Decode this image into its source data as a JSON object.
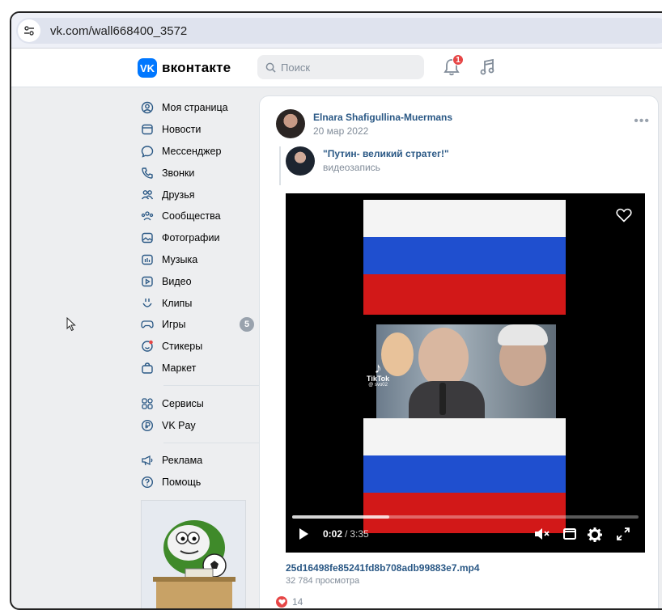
{
  "browser": {
    "url": "vk.com/wall668400_3572"
  },
  "header": {
    "logo_text": "вконтакте",
    "logo_mark": "VK",
    "search_placeholder": "Поиск",
    "notification_count": "1"
  },
  "sidebar": {
    "items": [
      {
        "label": "Моя страница",
        "icon": "user-circle-icon"
      },
      {
        "label": "Новости",
        "icon": "news-icon"
      },
      {
        "label": "Мессенджер",
        "icon": "chat-icon"
      },
      {
        "label": "Звонки",
        "icon": "phone-icon"
      },
      {
        "label": "Друзья",
        "icon": "friends-icon"
      },
      {
        "label": "Сообщества",
        "icon": "communities-icon"
      },
      {
        "label": "Фотографии",
        "icon": "photos-icon"
      },
      {
        "label": "Музыка",
        "icon": "music-icon"
      },
      {
        "label": "Видео",
        "icon": "video-icon"
      },
      {
        "label": "Клипы",
        "icon": "clips-icon"
      },
      {
        "label": "Игры",
        "icon": "games-icon",
        "count": "5"
      },
      {
        "label": "Стикеры",
        "icon": "stickers-icon"
      },
      {
        "label": "Маркет",
        "icon": "market-icon"
      }
    ],
    "services": [
      {
        "label": "Сервисы",
        "icon": "services-icon"
      },
      {
        "label": "VK Pay",
        "icon": "vkpay-icon"
      }
    ],
    "misc": [
      {
        "label": "Реклама",
        "icon": "megaphone-icon"
      },
      {
        "label": "Помощь",
        "icon": "help-icon"
      }
    ]
  },
  "post": {
    "author": "Elnara Shafigullina-Muermans",
    "date": "20 мар 2022",
    "repost": {
      "title": "\"Путин- великий стратег!\"",
      "subtitle": "видеозапись"
    },
    "video": {
      "watermark": "TikTok",
      "watermark_handle": "@ svo02",
      "time_current": "0:02",
      "time_separator": "/",
      "time_total": "3:35",
      "progress": 0.28
    },
    "filename": "25d16498fe85241fd8b708adb99883e7.mp4",
    "views": "32 784 просмотра",
    "likes": "14"
  },
  "colors": {
    "accent": "#0077ff",
    "link": "#2a5885",
    "muted": "#818c99",
    "like": "#e64646"
  }
}
